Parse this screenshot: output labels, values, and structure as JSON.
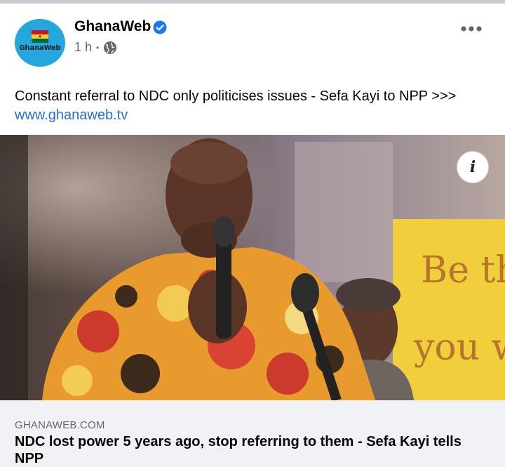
{
  "post": {
    "page_name": "GhanaWeb",
    "logo_text": "GhanaWeb",
    "time": "1 h",
    "separator": "•",
    "text": "Constant referral to NDC only politicises issues - Sefa Kayi to NPP >>>",
    "link": "www.ghanaweb.tv"
  },
  "photo": {
    "sign_text_line1": "Be th",
    "sign_text_line2": "you w",
    "info_label": "i"
  },
  "link_preview": {
    "domain": "GHANAWEB.COM",
    "headline": "NDC lost power 5 years ago, stop referring to them - Sefa Kayi tells NPP"
  },
  "icons": {
    "verified": "verified-badge-icon",
    "audience": "globe-icon",
    "more": "more-options-icon",
    "info": "info-icon"
  },
  "colors": {
    "link": "#216fdb",
    "verified": "#1877f2",
    "avatar": "#25a7de",
    "secondary_text": "#65676b",
    "preview_bg": "#f0f2f5"
  }
}
